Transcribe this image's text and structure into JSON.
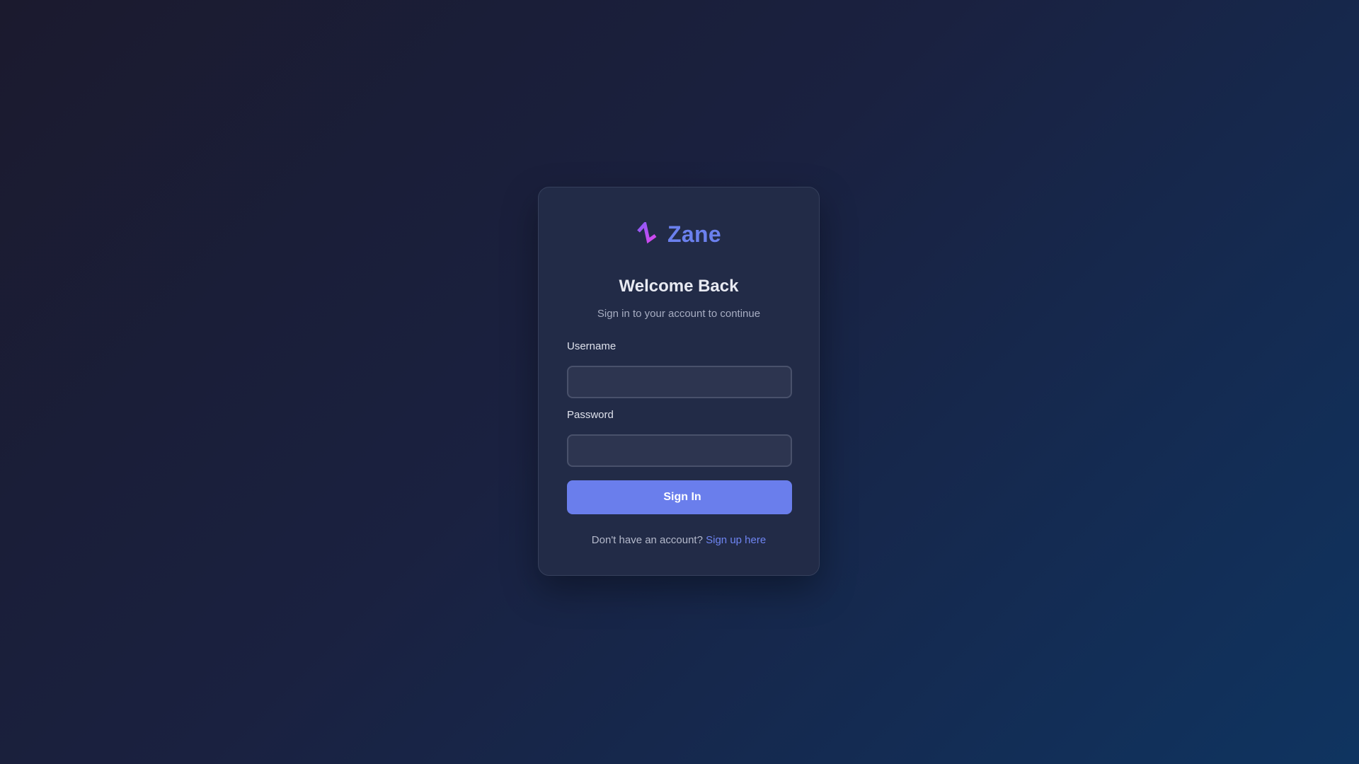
{
  "brand": {
    "name": "Zane",
    "logo_icon": "zigzag-bolt-icon",
    "logo_colors": [
      "#8b5cf6",
      "#d946ef"
    ],
    "text_color": "#6b80ee"
  },
  "login": {
    "title": "Welcome Back",
    "subtitle": "Sign in to your account to continue",
    "username_label": "Username",
    "username_value": "",
    "password_label": "Password",
    "password_value": "",
    "submit_icon": "",
    "submit_icon_name": "sign-in-icon",
    "submit_label": "Sign In",
    "footer_text": "Don't have an account?",
    "signup_link": "Sign up here"
  },
  "colors": {
    "accent": "#6a7eec",
    "link": "#6f85f2",
    "card": "#222b47"
  }
}
